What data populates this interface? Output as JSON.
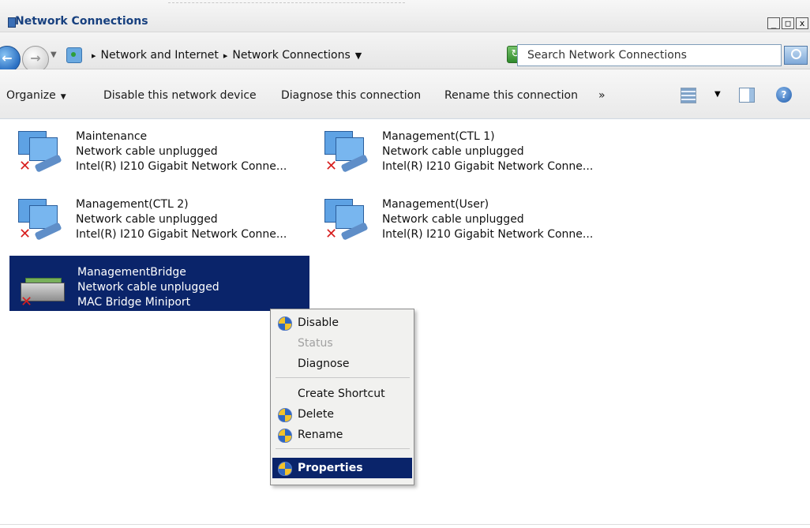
{
  "window": {
    "title": "Network Connections",
    "buttons": [
      "_",
      "□",
      "x"
    ]
  },
  "address_bar": {
    "breadcrumb": [
      "Network and Internet",
      "Network Connections"
    ],
    "search_placeholder": "Search Network Connections"
  },
  "toolbar": {
    "organize": "Organize",
    "disable": "Disable this network device",
    "diagnose": "Diagnose this connection",
    "rename": "Rename this connection",
    "more": "»"
  },
  "connections": [
    {
      "name": "Maintenance",
      "status": "Network cable unplugged",
      "device": "Intel(R) I210 Gigabit Network Conne..."
    },
    {
      "name": "Management(CTL 1)",
      "status": "Network cable unplugged",
      "device": "Intel(R) I210 Gigabit Network Conne..."
    },
    {
      "name": "Management(CTL 2)",
      "status": "Network cable unplugged",
      "device": "Intel(R) I210 Gigabit Network Conne..."
    },
    {
      "name": "Management(User)",
      "status": "Network cable unplugged",
      "device": "Intel(R) I210 Gigabit Network Conne..."
    },
    {
      "name": "ManagementBridge",
      "status": "Network cable unplugged",
      "device": "MAC Bridge Miniport"
    }
  ],
  "context_menu": {
    "items": [
      {
        "label": "Disable",
        "icon": "shield-icon",
        "state": "normal"
      },
      {
        "label": "Status",
        "icon": "",
        "state": "disabled"
      },
      {
        "label": "Diagnose",
        "icon": "",
        "state": "normal"
      },
      {
        "label": "Create Shortcut",
        "icon": "",
        "state": "normal"
      },
      {
        "label": "Delete",
        "icon": "shield-icon",
        "state": "normal"
      },
      {
        "label": "Rename",
        "icon": "shield-icon",
        "state": "normal"
      },
      {
        "label": "Properties",
        "icon": "shield-icon",
        "state": "selected"
      }
    ]
  },
  "colors": {
    "selection": "#0a246a",
    "title_text": "#17407f",
    "error_x": "#d71e1e"
  }
}
